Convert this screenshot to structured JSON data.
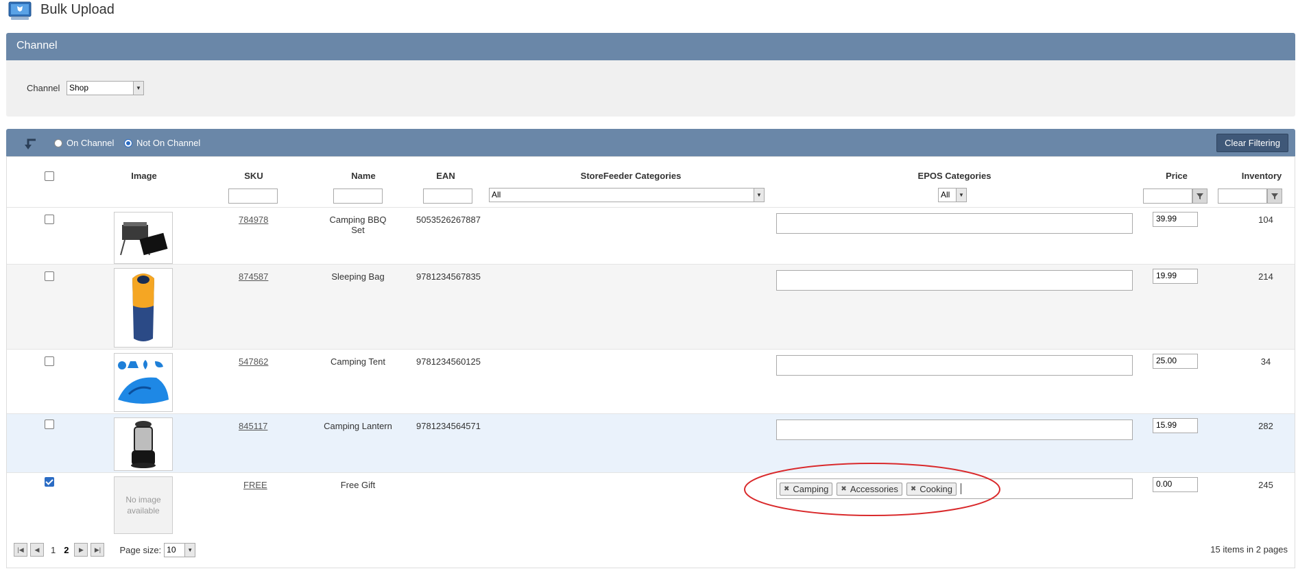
{
  "app": {
    "title": "Bulk Upload"
  },
  "channel_panel": {
    "header": "Channel",
    "label": "Channel",
    "selected": "Shop"
  },
  "toolbar": {
    "radio_on_channel": "On Channel",
    "radio_not_on_channel": "Not On Channel",
    "selected_radio": "Not On Channel",
    "clear_filtering": "Clear Filtering"
  },
  "columns": {
    "image": "Image",
    "sku": "SKU",
    "name": "Name",
    "ean": "EAN",
    "storefeeder": "StoreFeeder Categories",
    "epos": "EPOS Categories",
    "price": "Price",
    "inventory": "Inventory"
  },
  "filters": {
    "storefeeder": "All",
    "epos": "All"
  },
  "rows": [
    {
      "sku": "784978",
      "name": "Camping BBQ Set",
      "ean": "5053526267887",
      "price": "39.99",
      "inventory": "104",
      "checked": false,
      "image": "bbq"
    },
    {
      "sku": "874587",
      "name": "Sleeping Bag",
      "ean": "9781234567835",
      "price": "19.99",
      "inventory": "214",
      "checked": false,
      "image": "sleeping-bag"
    },
    {
      "sku": "547862",
      "name": "Camping Tent",
      "ean": "9781234560125",
      "price": "25.00",
      "inventory": "34",
      "checked": false,
      "image": "tent"
    },
    {
      "sku": "845117",
      "name": "Camping Lantern",
      "ean": "9781234564571",
      "price": "15.99",
      "inventory": "282",
      "checked": false,
      "image": "lantern"
    },
    {
      "sku": "FREE",
      "name": "Free Gift",
      "ean": "",
      "price": "0.00",
      "inventory": "245",
      "checked": true,
      "image": "none",
      "no_image_text": "No image available",
      "epos_tags": [
        "Camping",
        "Accessories",
        "Cooking"
      ]
    }
  ],
  "pager": {
    "pages": [
      "1",
      "2"
    ],
    "current": "2",
    "page_size_label": "Page size:",
    "page_size": "10",
    "items_info": "15 items in 2 pages"
  },
  "colors": {
    "header_bg": "#6a87a8",
    "button_bg": "#3f5878",
    "annotation": "#d9292b",
    "checkbox_checked": "#2b6cc4"
  }
}
